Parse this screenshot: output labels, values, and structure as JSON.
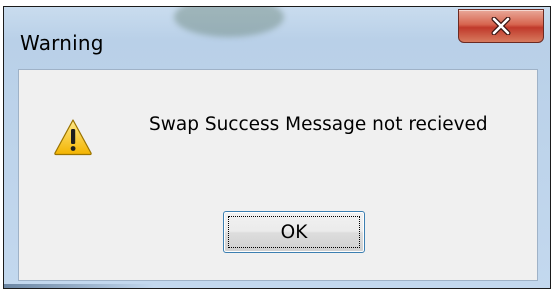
{
  "window": {
    "title": "Warning"
  },
  "dialog": {
    "icon": "warning-triangle-icon",
    "message": "Swap Success Message not recieved",
    "ok_label": "OK"
  },
  "colors": {
    "close_button": "#c0392b",
    "ok_border": "#3c7fb1",
    "dialog_bg": "#f0f0f0",
    "frame_bg": "#c3d8ee"
  }
}
